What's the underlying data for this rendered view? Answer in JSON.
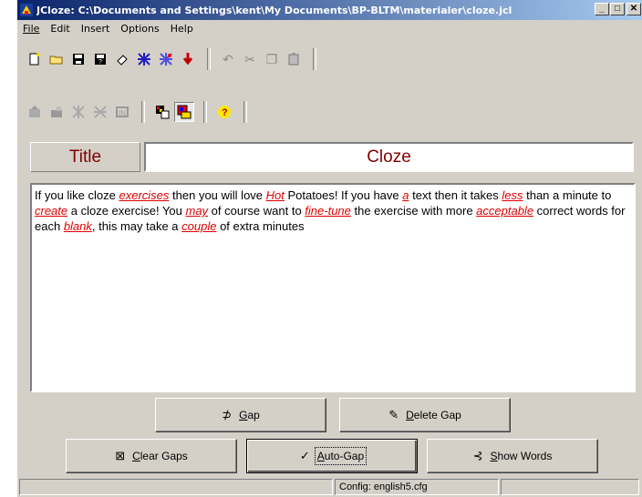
{
  "window": {
    "title": "JCloze: C:\\Documents and Settings\\kent\\My Documents\\BP-BLTM\\materialer\\cloze.jcl",
    "minimize": "_",
    "maximize": "□",
    "close": "✕"
  },
  "menu": [
    "File",
    "Edit",
    "Insert",
    "Options",
    "Help"
  ],
  "toolbar1_icons": [
    "new-file-icon",
    "open-folder-icon",
    "save-icon",
    "save-as-icon",
    "eraser-icon",
    "web-export-icon",
    "web-export2-icon",
    "export-arrow-icon",
    "undo-icon",
    "cut-icon",
    "copy-icon",
    "paste-icon"
  ],
  "toolbar2_icons": [
    "gap-tool-icon",
    "add-tool-icon",
    "alternate-tool-icon",
    "hint-tool-icon",
    "clue-tool-icon",
    "config-icon",
    "screen-icon",
    "help-icon"
  ],
  "title_label": "Title",
  "title_value": "Cloze",
  "editor_segments": [
    {
      "text": "If you like cloze ",
      "gap": false
    },
    {
      "text": "exercises",
      "gap": true
    },
    {
      "text": " then you will love ",
      "gap": false
    },
    {
      "text": "Hot",
      "gap": true
    },
    {
      "text": " Potatoes! If you have ",
      "gap": false
    },
    {
      "text": "a",
      "gap": true
    },
    {
      "text": " text then it takes ",
      "gap": false
    },
    {
      "text": "less",
      "gap": true
    },
    {
      "text": " than a minute to ",
      "gap": false
    },
    {
      "text": "create",
      "gap": true
    },
    {
      "text": " a cloze exercise! You ",
      "gap": false
    },
    {
      "text": "may",
      "gap": true
    },
    {
      "text": " of course want to ",
      "gap": false
    },
    {
      "text": "fine-tune",
      "gap": true
    },
    {
      "text": " the exercise with more ",
      "gap": false
    },
    {
      "text": "acceptable",
      "gap": true
    },
    {
      "text": " correct words for each ",
      "gap": false
    },
    {
      "text": "blank",
      "gap": true
    },
    {
      "text": ", this may take a ",
      "gap": false
    },
    {
      "text": "couple",
      "gap": true
    },
    {
      "text": " of extra minutes",
      "gap": false
    }
  ],
  "buttons": {
    "gap": {
      "mnemonic": "G",
      "rest": "ap"
    },
    "delete_gap": {
      "mnemonic": "D",
      "rest": "elete Gap"
    },
    "clear_gaps": {
      "mnemonic": "C",
      "rest": "lear Gaps"
    },
    "auto_gap": {
      "mnemonic": "A",
      "rest": "uto-Gap"
    },
    "show_words": {
      "mnemonic": "S",
      "rest": "how Words"
    }
  },
  "status": {
    "panel1": "",
    "panel2": "Config: english5.cfg",
    "panel3": ""
  }
}
